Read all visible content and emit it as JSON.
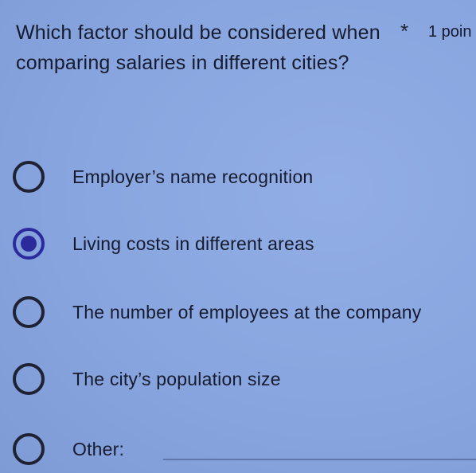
{
  "question": {
    "text": "Which factor should be considered when comparing salaries in different cities?",
    "required_marker": "*",
    "points": "1 poin"
  },
  "options": [
    {
      "label": "Employer’s name recognition",
      "selected": false
    },
    {
      "label": "Living costs in different areas",
      "selected": true
    },
    {
      "label": "The number of employees at the company",
      "selected": false
    },
    {
      "label": "The city’s population size",
      "selected": false
    },
    {
      "label": "Other:",
      "selected": false
    }
  ],
  "colors": {
    "background": "#8aa7e0",
    "text": "#161b2e",
    "selected_radio": "#2b2a9c"
  }
}
